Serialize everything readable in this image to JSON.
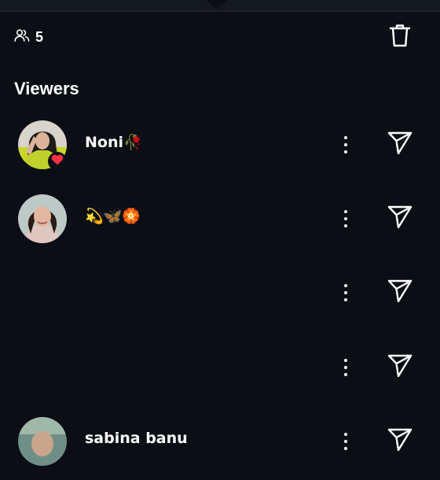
{
  "header": {
    "viewer_count": "5",
    "viewers_icon": "people-icon",
    "delete_icon": "trash-icon"
  },
  "section": {
    "title": "Viewers"
  },
  "viewers": [
    {
      "name": "Noni🥀",
      "liked": true
    },
    {
      "name": "💫🦋🏵️",
      "liked": false
    },
    {
      "name": "",
      "liked": false
    },
    {
      "name": "",
      "liked": false
    },
    {
      "name": "sabina banu",
      "liked": false
    }
  ],
  "colors": {
    "background": "#0b0e14",
    "text": "#ffffff",
    "heart": "#ff3040"
  }
}
